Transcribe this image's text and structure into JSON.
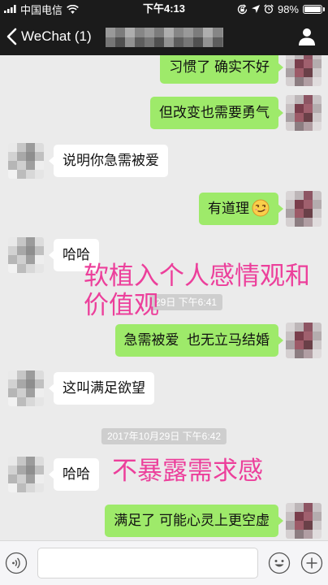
{
  "status_bar": {
    "carrier": "中国电信",
    "time": "下午4:13",
    "battery_text": "98%",
    "battery_level": 0.98,
    "icons": {
      "signal": "signal-bars-icon",
      "wifi": "wifi-icon",
      "rotation_lock": "rotation-lock-icon",
      "location": "location-arrow-icon",
      "alarm": "alarm-clock-icon",
      "battery": "battery-icon"
    }
  },
  "nav": {
    "back_label": "WeChat (1)",
    "back_icon": "chevron-left-icon",
    "right_icon": "person-icon"
  },
  "colors": {
    "nav_bar": "#1b1b1b",
    "chat_background": "#ebebeb",
    "sent_bubble": "#9eea6a",
    "received_bubble": "#ffffff",
    "timestamp_pill": "#cecece",
    "annotation_text": "#ec3f9b"
  },
  "messages": [
    {
      "side": "sent",
      "text": "习惯了 确实不好"
    },
    {
      "side": "sent",
      "text": "但改变也需要勇气"
    },
    {
      "side": "received",
      "text": "说明你急需被爱"
    },
    {
      "side": "sent",
      "text": "有道理",
      "emoji": "smirk-emoji-icon"
    },
    {
      "side": "received",
      "text": "哈哈"
    },
    {
      "side": "sent",
      "text": "急需被爱  也无立马结婚"
    },
    {
      "side": "received",
      "text": "这叫满足欲望"
    },
    {
      "side": "received",
      "text": "哈哈"
    },
    {
      "side": "sent",
      "text": "满足了 可能心灵上更空虚"
    }
  ],
  "timestamps": [
    "29日 下午6:41",
    "2017年10月29日 下午6:42"
  ],
  "annotations": [
    {
      "lines": [
        "软植入个人感情观和",
        "价值观"
      ]
    },
    {
      "lines": [
        "不暴露需求感"
      ]
    }
  ],
  "input_bar": {
    "voice_icon": "voice-input-icon",
    "emoji_icon": "emoji-icon",
    "more_icon": "plus-circle-icon"
  }
}
